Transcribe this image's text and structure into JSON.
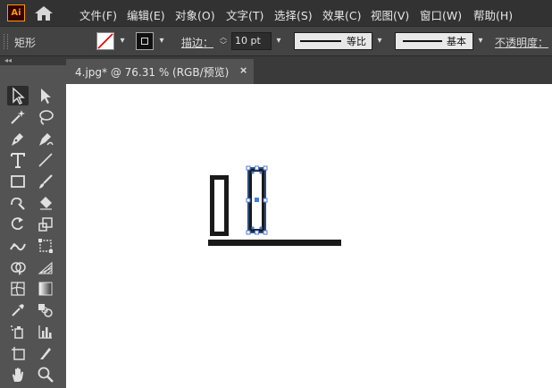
{
  "app": {
    "logo_text": "Ai"
  },
  "menu": [
    "文件(F)",
    "编辑(E)",
    "对象(O)",
    "文字(T)",
    "选择(S)",
    "效果(C)",
    "视图(V)",
    "窗口(W)",
    "帮助(H)"
  ],
  "control_bar": {
    "object_type": "矩形",
    "stroke_label": "描边：",
    "stroke_weight": "10 pt",
    "profile_label": "等比",
    "brush_label": "基本",
    "opacity_label": "不透明度："
  },
  "document_tab": {
    "title": "4.jpg* @ 76.31 % (RGB/预览)",
    "close": "×"
  },
  "tools": [
    "selection-tool",
    "direct-selection-tool",
    "magic-wand-tool",
    "lasso-tool",
    "pen-tool",
    "curvature-tool",
    "type-tool",
    "line-segment-tool",
    "rectangle-tool",
    "paintbrush-tool",
    "shaper-tool",
    "eraser-tool",
    "rotate-tool",
    "scale-tool",
    "puppet-warp-tool",
    "free-transform-tool",
    "shape-builder-tool",
    "perspective-grid-tool",
    "mesh-tool",
    "gradient-tool",
    "eyedropper-tool",
    "blend-tool",
    "symbol-sprayer-tool",
    "column-graph-tool",
    "artboard-tool",
    "slice-tool",
    "hand-tool",
    "zoom-tool"
  ],
  "colors": {
    "menubar": "#323232",
    "panel": "#535353",
    "canvas": "#ffffff",
    "selection": "#4a7bd8"
  }
}
